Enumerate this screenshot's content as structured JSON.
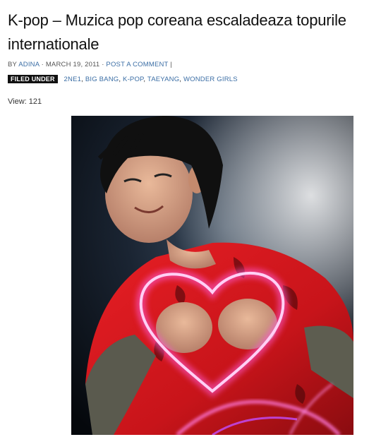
{
  "post": {
    "title": "K-pop – Muzica pop coreana escaladeaza topurile internationale",
    "meta": {
      "by": "BY",
      "author": "ADINA",
      "sep1": "·",
      "date": "MARCH 19, 2011",
      "sep2": "·",
      "comment_link": "POST A COMMENT",
      "sep3": "|"
    },
    "filed": {
      "badge": "FILED UNDER",
      "tags": [
        "2NE1",
        "BIG BANG",
        "K-POP",
        "TAEYANG",
        "WONDER GIRLS"
      ]
    },
    "views": "View: 121"
  },
  "colors": {
    "link": "#3b6ea5",
    "badge_bg": "#111111",
    "shirt_red": "#d0161c",
    "heart_glow": "#ff7be0"
  }
}
